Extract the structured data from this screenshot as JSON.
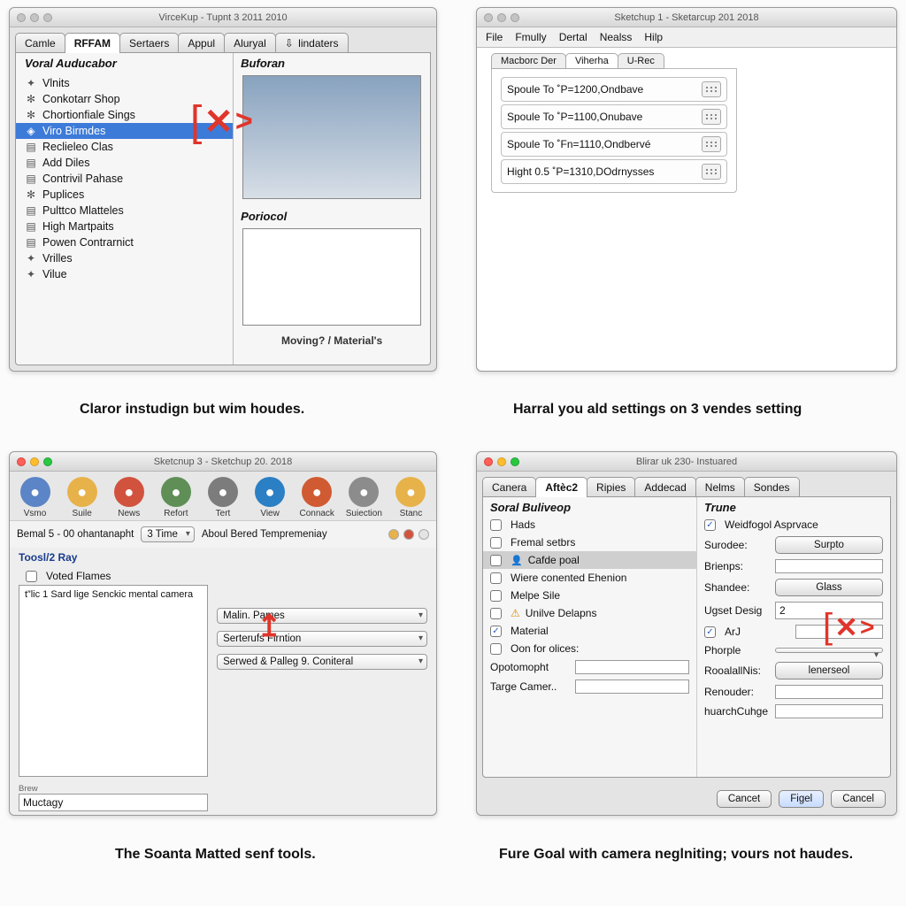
{
  "panel1": {
    "title": "VirceKup - Tupnt 3 2011 2010",
    "tabs": [
      "Camle",
      "RFFAM",
      "Sertaers",
      "Appul",
      "Aluryal",
      "lindaters"
    ],
    "active_tab_index": 1,
    "tree_heading": "Voral Auducabor",
    "tree_items": [
      "Vlnits",
      "Conkotarr Shop",
      "Chortionfiale Sings",
      "Viro Birmdes",
      "Reclieleo Clas",
      "Add Diles",
      "Contrivil Pahase",
      "Puplices",
      "Pulttco Mlatteles",
      "High Martpaits",
      "Powen Contrarnict",
      "Vrilles",
      "Vilue"
    ],
    "selected_tree_index": 3,
    "right_label_1": "Buforan",
    "right_label_2": "Poriocol",
    "bottom_link": "Moving? / Material's",
    "caption": "Claror instudign but wim houdes."
  },
  "panel2": {
    "title": "Sketchup 1 - Sketarcup 201 2018",
    "menus": [
      "File",
      "Fmully",
      "Dertal",
      "Nealss",
      "Hilp"
    ],
    "subtabs": [
      "Macborc Der",
      "Viherha",
      "U-Rec"
    ],
    "active_subtab": 1,
    "rows": [
      "Spoule To  ˚P=1200,Ondbave",
      "Spoule To  ˚P=1100,Onubave",
      "Spoule To  ˚Fn=1110,Ondbervé",
      "Hight 0.5  ˚P=1310,DOdrnysses"
    ],
    "caption": "Harral you ald settings on 3 vendes setting"
  },
  "panel3": {
    "title": "Sketcnup 3 - Sketchup 20. 2018",
    "toolbar": [
      {
        "label": "Vsmo",
        "bg": "#5b85c6"
      },
      {
        "label": "Suile",
        "bg": "#e7b24a"
      },
      {
        "label": "News",
        "bg": "#d1533e"
      },
      {
        "label": "Refort",
        "bg": "#5f8f56"
      },
      {
        "label": "Tert",
        "bg": "#7c7c7c"
      },
      {
        "label": "View",
        "bg": "#2b7fc4"
      },
      {
        "label": "Connack",
        "bg": "#d05a32"
      },
      {
        "label": "Suiection",
        "bg": "#8c8c8c"
      },
      {
        "label": "Stanc",
        "bg": "#e7b24a"
      }
    ],
    "info_left": "Bemal 5 - 00 ohantanapht",
    "info_combo": "3 Time",
    "info_right": "Aboul Bered Tempremeniay",
    "section_label": "Toosl/2 Ray",
    "check_label": "Voted Flames",
    "tree_line": "t”lic 1 Sard lige Senckic   mental camera",
    "combos": [
      "Malin. Pames",
      "Serterufs Firntion",
      "Serwed & Palleg 9. Coniteral"
    ],
    "bottom_field_label": "Brew",
    "bottom_field_value": "Muctagy",
    "caption": "The Soanta Matted senf tools."
  },
  "panel4": {
    "title": "Blirar uk 230- Instuared",
    "tabs": [
      "Canera",
      "Aftèc2",
      "Ripies",
      "Addecad",
      "Nelms",
      "Sondes"
    ],
    "active_tab_index": 1,
    "left_heading": "Soral Buliveop",
    "left_items": [
      {
        "label": "Hads",
        "checked": false
      },
      {
        "label": "Fremal setbrs",
        "checked": false
      },
      {
        "label": "Cafde poal",
        "checked": false,
        "icon": true
      },
      {
        "label": "Wiere conented Ehenion",
        "checked": false
      },
      {
        "label": "Melpe Sile",
        "checked": false
      },
      {
        "label": "Unilve Delapns",
        "checked": false,
        "warn": true
      },
      {
        "label": "Material",
        "checked": true
      },
      {
        "label": "Oon for olices:",
        "checked": false
      }
    ],
    "left_fields": [
      {
        "label": "Opotomopht",
        "value": ""
      },
      {
        "label": "Targe Camer..",
        "value": ""
      }
    ],
    "right_heading": "Trune",
    "right_rows": [
      {
        "kind": "check",
        "label": "Weidfogol Asprvace",
        "checked": true
      },
      {
        "kind": "labelbtn",
        "label": "Surodee:",
        "btn": "Surpto"
      },
      {
        "kind": "labelfield",
        "label": "Brienps:",
        "value": ""
      },
      {
        "kind": "labelbtn",
        "label": "Shandee:",
        "btn": "Glass"
      },
      {
        "kind": "labelfield",
        "label": "Ugset Desig",
        "value": "2"
      },
      {
        "kind": "checkfield",
        "label": "ArJ",
        "checked": true,
        "value": ""
      },
      {
        "kind": "labelcombo",
        "label": "Phorple",
        "value": ""
      },
      {
        "kind": "labelbtn",
        "label": "RooalallNis:",
        "btn": "lenerseol"
      },
      {
        "kind": "labelfield",
        "label": "Renouder:",
        "value": ""
      },
      {
        "kind": "labelfield",
        "label": "huarchCuhge",
        "value": ""
      }
    ],
    "buttons": [
      "Cancet",
      "Figel",
      "Cancel"
    ],
    "caption": "Fure Goal with camera neglniting; vours not haudes."
  }
}
